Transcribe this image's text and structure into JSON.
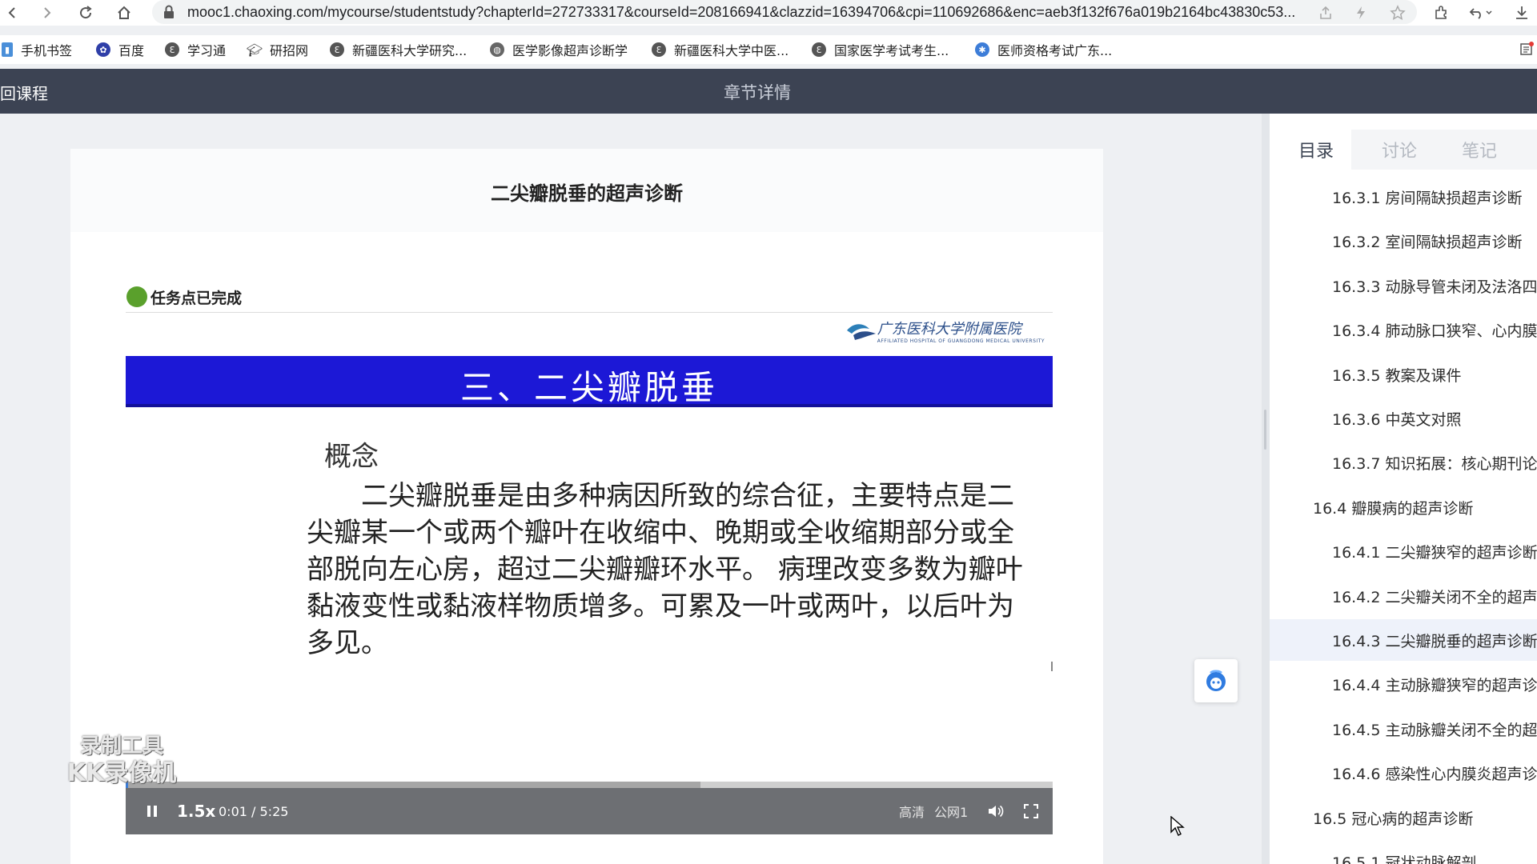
{
  "browser": {
    "url": "mooc1.chaoxing.com/mycourse/studentstudy?chapterId=272733317&courseId=208166941&clazzid=16394706&cpi=110692686&enc=aeb3f132f676a019b2164bc43830c53...",
    "bookmarks": [
      {
        "label": "手机书签",
        "icon": "mobile-bookmark-icon",
        "color": "#4a8fd9"
      },
      {
        "label": "百度",
        "icon": "baidu-paw-icon",
        "color": "#2f3fa8"
      },
      {
        "label": "学习通",
        "icon": "xuexitong-icon",
        "color": "#555555"
      },
      {
        "label": "研招网",
        "icon": "graduation-cap-icon",
        "color": "#333333"
      },
      {
        "label": "新疆医科大学研究...",
        "icon": "xuexitong-icon",
        "color": "#555555"
      },
      {
        "label": "医学影像超声诊断学",
        "icon": "globe-icon",
        "color": "#666666"
      },
      {
        "label": "新疆医科大学中医...",
        "icon": "xuexitong-icon",
        "color": "#555555"
      },
      {
        "label": "国家医学考试考生...",
        "icon": "xuexitong-icon",
        "color": "#555555"
      },
      {
        "label": "医师资格考试广东...",
        "icon": "exam-site-icon",
        "color": "#3d7dd8"
      }
    ]
  },
  "app_header": {
    "back_label": "回课程",
    "title": "章节详情"
  },
  "content": {
    "title": "二尖瓣脱垂的超声诊断",
    "task_status": "任务点已完成"
  },
  "slide": {
    "logo_text": "广东医科大学附属医院",
    "logo_sub": "AFFILIATED HOSPITAL OF GUANGDONG MEDICAL UNIVERSITY",
    "heading": "三、二尖瓣脱垂",
    "concept": "概念",
    "body": "二尖瓣脱垂是由多种病因所致的综合征，主要特点是二尖瓣某一个或两个瓣叶在收缩中、晚期或全收缩期部分或全部脱向左心房，超过二尖瓣瓣环水平。 病理改变多数为瓣叶黏液变性或黏液样物质增多。可累及一叶或两叶，以后叶为多见。"
  },
  "watermark": {
    "line1": "录制工具",
    "line2": "KK录像机"
  },
  "player": {
    "rate": "1.5x",
    "time": "0:01 / 5:25",
    "quality": "高清",
    "line": "公网1",
    "played_fraction": 0.003,
    "buffered_fraction": 0.62,
    "accent": "#3a7bd5"
  },
  "sidebar": {
    "tabs": [
      "目录",
      "讨论",
      "笔记"
    ],
    "active_tab": 0,
    "items": [
      {
        "label": "16.3.1 房间隔缺损超声诊断",
        "level": 3
      },
      {
        "label": "16.3.2 室间隔缺损超声诊断",
        "level": 3
      },
      {
        "label": "16.3.3 动脉导管未闭及法洛四",
        "level": 3
      },
      {
        "label": "16.3.4 肺动脉口狭窄、心内膜",
        "level": 3
      },
      {
        "label": "16.3.5 教案及课件",
        "level": 3
      },
      {
        "label": "16.3.6 中英文对照",
        "level": 3
      },
      {
        "label": "16.3.7 知识拓展：核心期刊论",
        "level": 3
      },
      {
        "label": "16.4 瓣膜病的超声诊断",
        "level": 2
      },
      {
        "label": "16.4.1 二尖瓣狭窄的超声诊断",
        "level": 3
      },
      {
        "label": "16.4.2 二尖瓣关闭不全的超声",
        "level": 3
      },
      {
        "label": "16.4.3 二尖瓣脱垂的超声诊断",
        "level": 3,
        "selected": true
      },
      {
        "label": "16.4.4 主动脉瓣狭窄的超声诊",
        "level": 3
      },
      {
        "label": "16.4.5 主动脉瓣关闭不全的超",
        "level": 3
      },
      {
        "label": "16.4.6 感染性心内膜炎超声诊",
        "level": 3
      },
      {
        "label": "16.5 冠心病的超声诊断",
        "level": 2
      },
      {
        "label": "16.5.1 冠状动脉解剖",
        "level": 3
      }
    ]
  }
}
